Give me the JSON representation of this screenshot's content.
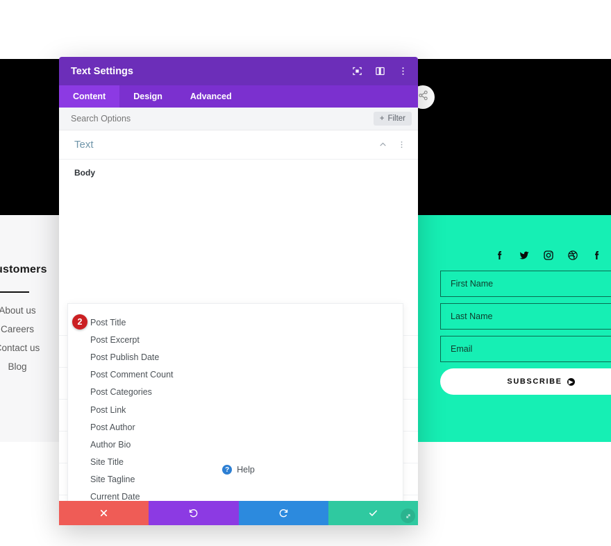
{
  "background": {
    "footer_column": {
      "title": "Customers",
      "links": [
        "About us",
        "Careers",
        "Contact us",
        "Blog"
      ]
    },
    "newsletter": {
      "social_icons": [
        "facebook-icon",
        "twitter-icon",
        "instagram-icon",
        "dribbble-icon",
        "facebook-icon"
      ],
      "fields": [
        {
          "name": "first-name-field",
          "placeholder": "First Name"
        },
        {
          "name": "last-name-field",
          "placeholder": "Last Name"
        },
        {
          "name": "email-field",
          "placeholder": "Email"
        }
      ],
      "subscribe_label": "SUBSCRIBE",
      "subscribe_icon": "arrow-right-icon"
    },
    "hero_circle_icon": "share-icon",
    "colors": {
      "hero": "#000000",
      "footer_teal": "#16efb4",
      "footer_gray": "#f7f7f8"
    }
  },
  "modal": {
    "title": "Text Settings",
    "header_icons": [
      "focus-icon",
      "layout-panel-icon",
      "more-vertical-icon"
    ],
    "tabs": [
      {
        "label": "Content",
        "active": true
      },
      {
        "label": "Design",
        "active": false
      },
      {
        "label": "Advanced",
        "active": false
      }
    ],
    "search": {
      "placeholder": "Search Options",
      "value": ""
    },
    "filter_label": "Filter",
    "filter_icon": "plus-icon",
    "section": {
      "title": "Text",
      "toggle_icon": "chevron-up-icon",
      "menu_icon": "more-vertical-icon"
    },
    "field_label": "Body",
    "dropdown": {
      "items": [
        "Post Title",
        "Post Excerpt",
        "Post Publish Date",
        "Post Comment Count",
        "Post Categories",
        "Post Link",
        "Post Author",
        "Author Bio",
        "Site Title",
        "Site Tagline",
        "Current Date"
      ]
    },
    "step_badge": "2",
    "help_label": "Help",
    "help_icon": "question-mark-icon",
    "footer_buttons": [
      {
        "name": "cancel-button",
        "icon": "close-icon",
        "color": "#ef5c56"
      },
      {
        "name": "undo-button",
        "icon": "undo-icon",
        "color": "#8c3ae3"
      },
      {
        "name": "redo-button",
        "icon": "redo-icon",
        "color": "#2c8ade"
      },
      {
        "name": "save-button",
        "icon": "check-icon",
        "color": "#2fc9a0"
      }
    ],
    "resize_icon": "resize-handle-icon",
    "colors": {
      "header": "#6c2eb9",
      "tabs": "#7b30cf",
      "tab_active": "#8c3ae3",
      "badge": "#cb1f22"
    }
  }
}
